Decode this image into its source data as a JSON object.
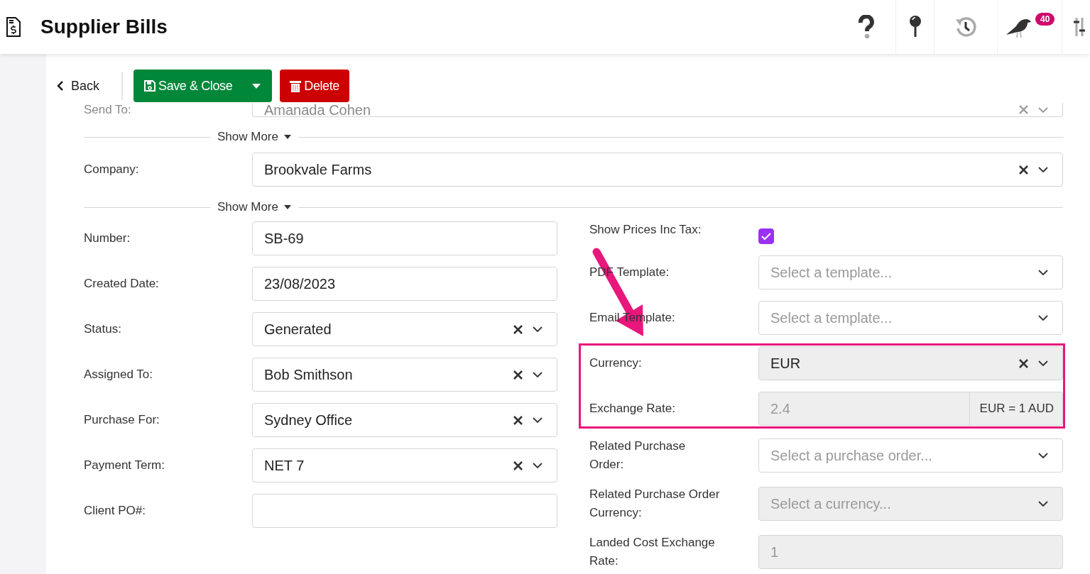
{
  "header": {
    "title": "Supplier Bills",
    "notification_count": "40"
  },
  "toolbar": {
    "back": "Back",
    "save": "Save & Close",
    "delete": "Delete"
  },
  "send_to": {
    "label": "Send To:",
    "value": "Amanada Cohen"
  },
  "show_more": [
    "Show More",
    "Show More"
  ],
  "company": {
    "label": "Company:",
    "value": "Brookvale Farms",
    "clearable": true
  },
  "left_fields": [
    {
      "kind": "input",
      "label": "Number:",
      "value": "SB-69"
    },
    {
      "kind": "input",
      "label": "Created Date:",
      "value": "23/08/2023"
    },
    {
      "kind": "select",
      "label": "Status:",
      "value": "Generated",
      "clearable": true,
      "disabled": false
    },
    {
      "kind": "select",
      "label": "Assigned To:",
      "value": "Bob Smithson",
      "clearable": true,
      "disabled": false
    },
    {
      "kind": "select",
      "label": "Purchase For:",
      "value": "Sydney Office",
      "clearable": true,
      "disabled": false
    },
    {
      "kind": "select",
      "label": "Payment Term:",
      "value": "NET 7",
      "clearable": true,
      "disabled": false
    },
    {
      "kind": "input",
      "label": "Client PO#:"
    }
  ],
  "right_fields": [
    {
      "kind": "checkbox",
      "label": "Show Prices Inc Tax:",
      "checked": true
    },
    {
      "kind": "select",
      "label": "PDF Template:",
      "placeholder": "Select a template...",
      "clearable": false,
      "disabled": false
    },
    {
      "kind": "select",
      "label": "Email Template:",
      "placeholder": "Select a template...",
      "clearable": false,
      "disabled": false
    },
    {
      "kind": "group",
      "highlighted": true,
      "fields": [
        {
          "kind": "select",
          "label": "Currency:",
          "value": "EUR",
          "clearable": true,
          "disabled": true
        },
        {
          "kind": "addon",
          "label": "Exchange Rate:",
          "value": "2.4",
          "addon": "EUR = 1 AUD",
          "disabled": true
        }
      ]
    },
    {
      "kind": "select",
      "label": "Related Purchase\nOrder:",
      "placeholder": "Select a purchase order...",
      "clearable": false,
      "disabled": false
    },
    {
      "kind": "select",
      "label": "Related Purchase Order\nCurrency:",
      "placeholder": "Select a currency...",
      "clearable": false,
      "disabled": true
    },
    {
      "kind": "input",
      "label": "Landed Cost Exchange\nRate:",
      "value": "1",
      "disabled": true
    }
  ],
  "annotation": {
    "kind": "arrow"
  }
}
